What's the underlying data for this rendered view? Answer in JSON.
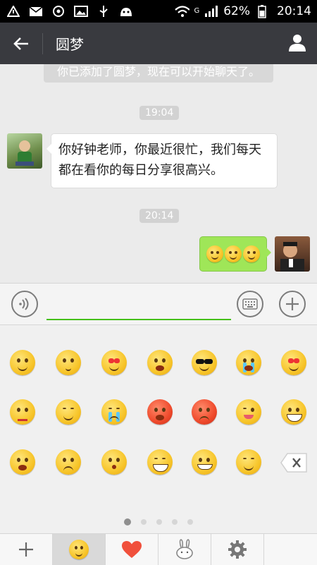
{
  "status_bar": {
    "network": "G",
    "battery": "62%",
    "time": "20:14"
  },
  "header": {
    "title": "圆梦",
    "back_icon": "back-arrow-icon",
    "profile_icon": "person-icon"
  },
  "chat": {
    "system_message": "你已添加了圆梦，现在可以开始聊天了。",
    "messages": [
      {
        "time": "19:04",
        "direction": "in",
        "text": "你好钟老师，你最近很忙，我们每天都在看你的每日分享很高兴。"
      },
      {
        "time": "20:14",
        "direction": "out",
        "emoji_count": 3,
        "emoji": "smile"
      }
    ]
  },
  "input_bar": {
    "voice_icon": "voice-icon",
    "keyboard_icon": "keyboard-icon",
    "more_icon": "plus-icon",
    "value": ""
  },
  "emoji_panel": {
    "rows": [
      [
        "smile",
        "shy",
        "heart-eyes",
        "startled",
        "cool",
        "crying",
        "drool"
      ],
      [
        "sealed",
        "sleepy",
        "upset",
        "angry-red",
        "angry",
        "wink",
        "grin"
      ],
      [
        "surprised",
        "sad",
        "embarrassed",
        "scream",
        "dizzy",
        "giggle"
      ]
    ],
    "delete_icon": "backspace-icon",
    "pages": 5,
    "current_page": 1
  },
  "tabs": [
    "plus-icon",
    "emoji-face-icon",
    "heart-icon",
    "rabbit-icon",
    "settings-gear-icon"
  ],
  "active_tab_index": 1,
  "colors": {
    "header_bg": "#393a3f",
    "outgoing_bubble": "#9fe658",
    "input_underline": "#45c01a"
  }
}
